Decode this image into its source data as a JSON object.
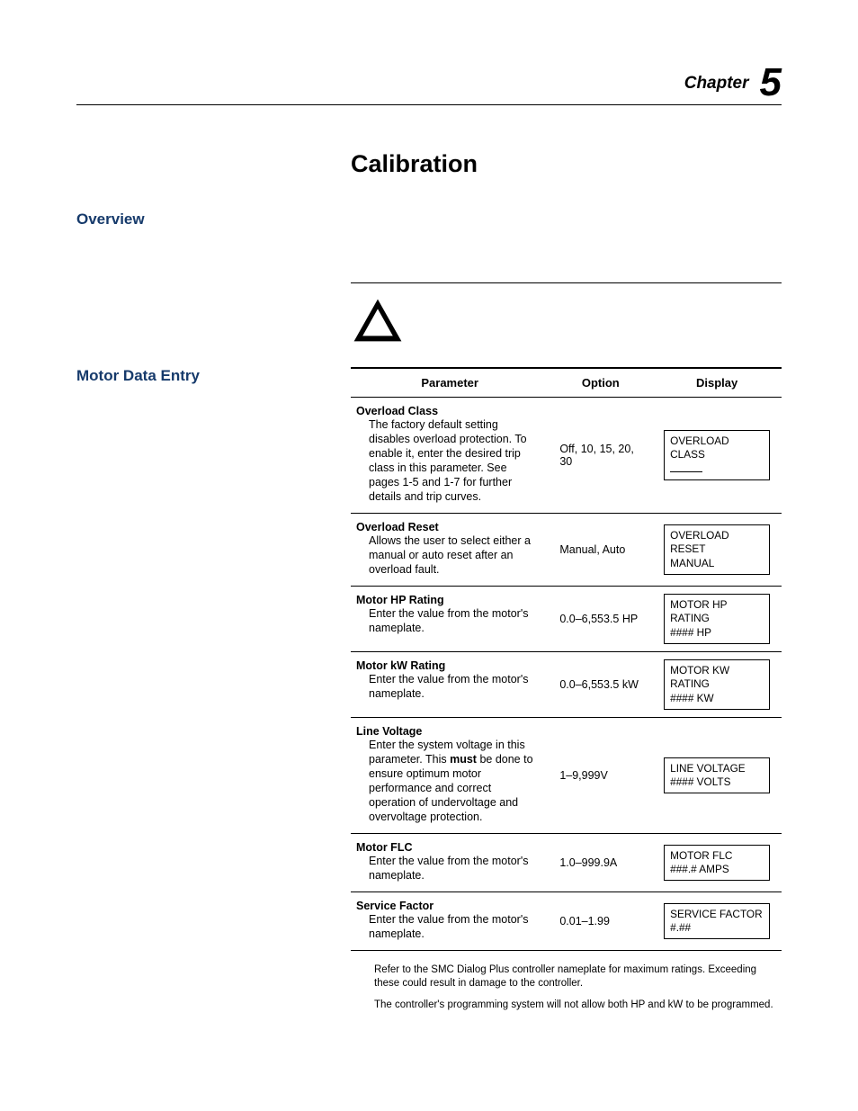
{
  "chapter": {
    "label": "Chapter",
    "number": "5"
  },
  "page_title": "Calibration",
  "sections": {
    "overview": "Overview",
    "motor_data_entry": "Motor Data Entry"
  },
  "table": {
    "headers": {
      "parameter": "Parameter",
      "option": "Option",
      "display": "Display"
    },
    "rows": [
      {
        "name": "Overload Class",
        "desc": "The factory default setting disables overload protection.  To enable it, enter the desired trip class in this parameter.  See pages 1-5 and 1-7 for further details and trip curves.",
        "option": "Off, 10, 15, 20, 30",
        "display_l1": "OVERLOAD CLASS",
        "display_l2_dash": true
      },
      {
        "name": "Overload Reset",
        "desc": "Allows the user to select either a manual or auto reset after an overload fault.",
        "option": "Manual, Auto",
        "display_l1": "OVERLOAD RESET",
        "display_l2": "MANUAL"
      },
      {
        "name": "Motor HP Rating",
        "desc": "Enter the value from the motor's nameplate.",
        "option": "0.0–6,553.5 HP",
        "display_l1": "MOTOR HP RATING",
        "display_l2": "#### HP"
      },
      {
        "name": "Motor kW Rating",
        "desc": "Enter the value from the motor's nameplate.",
        "option": "0.0–6,553.5 kW",
        "display_l1": "MOTOR KW RATING",
        "display_l2": "#### KW"
      },
      {
        "name": "Line Voltage",
        "desc_pre": "Enter the system voltage in this parameter. This ",
        "desc_bold": "must",
        "desc_post": " be done to ensure optimum motor performance and correct operation of undervoltage and overvoltage protection.",
        "option": "1–9,999V",
        "display_l1": "LINE VOLTAGE",
        "display_l2": "#### VOLTS"
      },
      {
        "name": "Motor FLC",
        "desc": "Enter the value from the motor's nameplate.",
        "option": "1.0–999.9A",
        "display_l1": "MOTOR FLC",
        "display_l2": "###.# AMPS"
      },
      {
        "name": "Service Factor",
        "desc": "Enter the value from the motor's nameplate.",
        "option": "0.01–1.99",
        "display_l1": "SERVICE FACTOR",
        "display_l2": "#.##"
      }
    ]
  },
  "footnotes": [
    "Refer to the SMC Dialog Plus controller nameplate for maximum ratings.  Exceeding these could result in damage to the controller.",
    "The controller's programming system will not allow both HP and kW to be programmed."
  ]
}
